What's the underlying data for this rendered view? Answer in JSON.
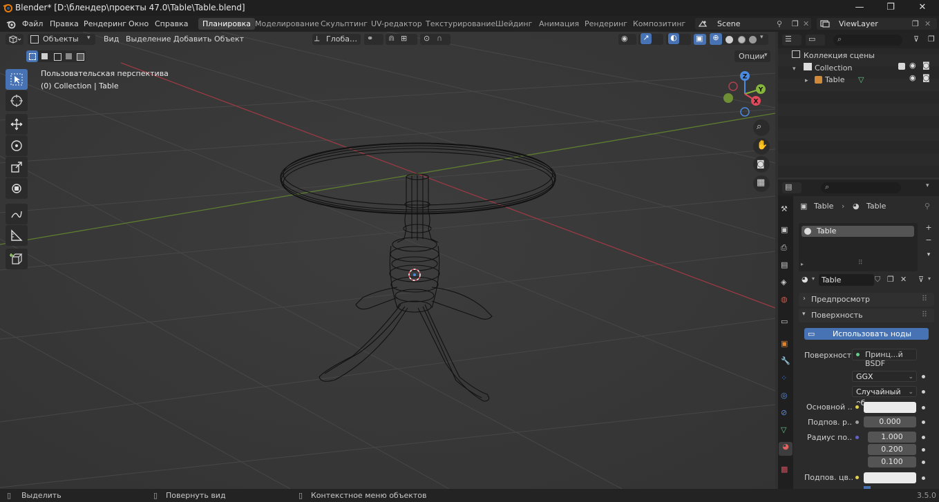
{
  "window": {
    "title": "Blender* [D:\\блендер\\проекты 47.0\\Table\\Table.blend]",
    "minimize": "—",
    "maximize": "❐",
    "close": "✕"
  },
  "menu": {
    "items": [
      "Файл",
      "Правка",
      "Рендеринг",
      "Окно",
      "Справка"
    ],
    "workspaces": [
      "Планировка",
      "Моделирование",
      "Скульптинг",
      "UV-редактор",
      "Текстурирование",
      "Шейдинг",
      "Анимация",
      "Рендеринг",
      "Композитинг"
    ],
    "active_workspace": "Планировка",
    "scene": "Scene",
    "view_layer": "ViewLayer"
  },
  "viewport_header": {
    "mode": "Объекты",
    "menus": [
      "Вид",
      "Выделение",
      "Добавить",
      "Объект"
    ],
    "orientation": "Глоба…",
    "options": "Опции"
  },
  "viewport": {
    "view_name": "Пользовательская перспектива",
    "collection_info": "(0) Collection | Table",
    "gizmo_axes": [
      "Z",
      "Y",
      "X"
    ]
  },
  "outliner": {
    "scene_collection": "Коллекция сцены",
    "collection": "Collection",
    "object": "Table"
  },
  "properties": {
    "breadcrumb_object": "Table",
    "breadcrumb_material": "Table",
    "slot_name": "Table",
    "material_name": "Table",
    "panel_preview": "Предпросмотр",
    "panel_surface": "Поверхность",
    "use_nodes": "Использовать ноды",
    "surface_label": "Поверхность",
    "surface_value": "Принц...й BSDF",
    "distribution": "GGX",
    "subsurface_method": "Случайный об...",
    "base_color_label": "Основной ...",
    "subsurface_label": "Подпов. р...",
    "subsurface_value": "0.000",
    "radius_label": "Радиус по...",
    "radius_values": [
      "1.000",
      "0.200",
      "0.100"
    ],
    "subsurface_color_label": "Подпов. цв..."
  },
  "statusbar": {
    "select": "Выделить",
    "rotate": "Повернуть вид",
    "context": "Контекстное меню объектов",
    "version": "3.5.0"
  },
  "colors": {
    "accent": "#4772b3",
    "axis_x": "#e04a5a",
    "axis_y": "#86b53c",
    "axis_z": "#4b8be0"
  }
}
